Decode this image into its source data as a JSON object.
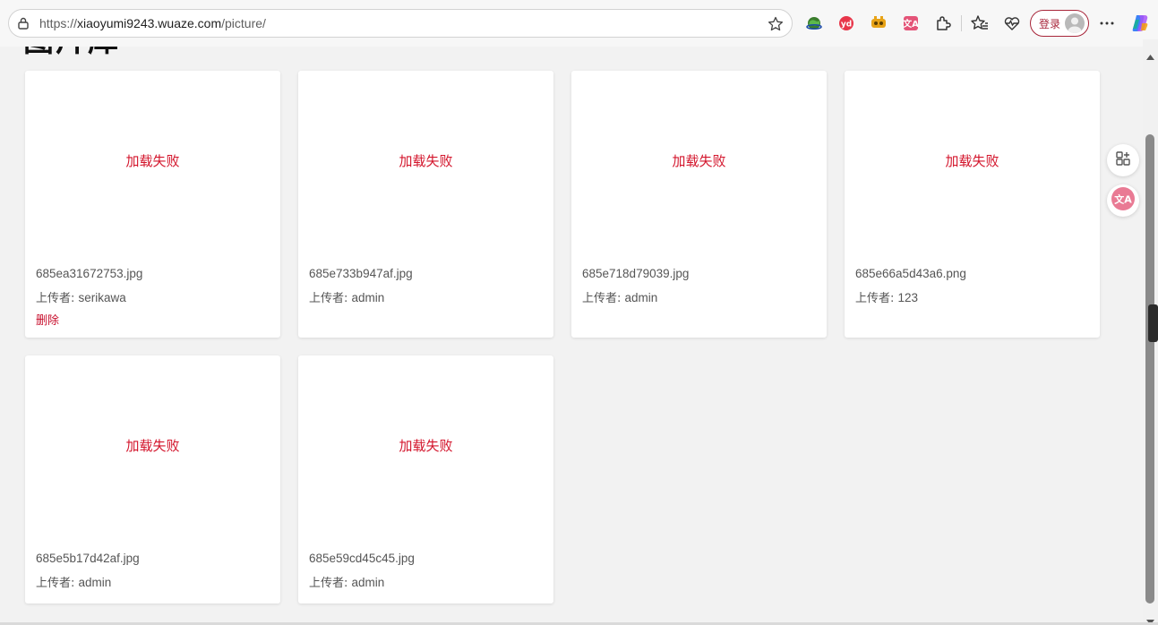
{
  "browser": {
    "url": {
      "scheme": "https://",
      "host": "xiaoyumi9243.wuaze.com",
      "path": "/picture/"
    },
    "login_label": "登录",
    "extensions": [
      "earth-extension-icon",
      "yd-translate-icon",
      "tampermonkey-icon",
      "translate-extension-icon",
      "puzzle-extensions-icon",
      "favorites-icon",
      "health-icon"
    ]
  },
  "page": {
    "heading": "图片库",
    "failed_text": "加载失败",
    "uploader_label": "上传者: ",
    "delete_label": "删除",
    "cards": [
      {
        "file": "685ea31672753.jpg",
        "uploader": "serikawa",
        "deletable": true
      },
      {
        "file": "685e733b947af.jpg",
        "uploader": "admin",
        "deletable": false
      },
      {
        "file": "685e718d79039.jpg",
        "uploader": "admin",
        "deletable": false
      },
      {
        "file": "685e66a5d43a6.png",
        "uploader": "123",
        "deletable": false
      },
      {
        "file": "685e5b17d42af.jpg",
        "uploader": "admin",
        "deletable": false
      },
      {
        "file": "685e59cd45c45.jpg",
        "uploader": "admin",
        "deletable": false
      }
    ]
  },
  "side_panel": {
    "buttons": [
      "add-app-icon",
      "translate-icon"
    ]
  },
  "colors": {
    "failed": "#d3142b",
    "delete": "#c8102e",
    "login_accent": "#a8263a",
    "page_bg": "#f2f2f2"
  }
}
